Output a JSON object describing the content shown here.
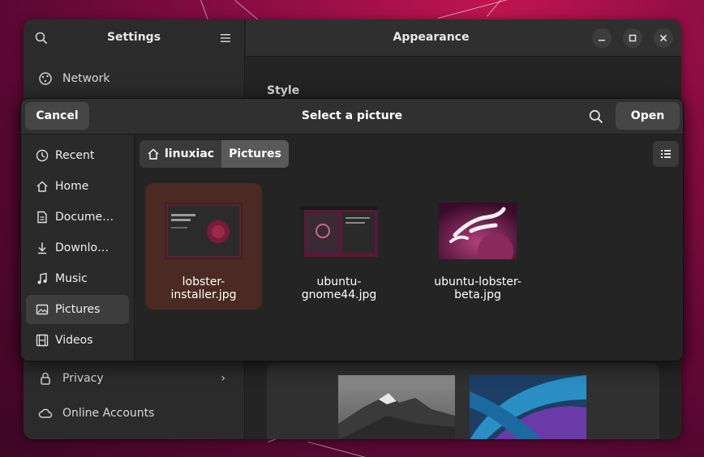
{
  "settings": {
    "sidebar_title": "Settings",
    "window_title": "Appearance",
    "style_label": "Style",
    "sidebar_items": [
      {
        "label": "Network",
        "icon": "network-icon"
      },
      {
        "label": "Privacy",
        "icon": "lock-icon"
      },
      {
        "label": "Online Accounts",
        "icon": "cloud-icon"
      }
    ]
  },
  "dialog": {
    "title": "Select a picture",
    "cancel_label": "Cancel",
    "open_label": "Open",
    "places": [
      {
        "label": "Recent",
        "icon": "clock-icon"
      },
      {
        "label": "Home",
        "icon": "home-icon"
      },
      {
        "label": "Documents",
        "icon": "document-icon"
      },
      {
        "label": "Downloads",
        "icon": "download-icon"
      },
      {
        "label": "Music",
        "icon": "music-icon"
      },
      {
        "label": "Pictures",
        "icon": "picture-icon"
      },
      {
        "label": "Videos",
        "icon": "film-icon"
      }
    ],
    "breadcrumb": {
      "home": "linuxiac",
      "current": "Pictures"
    },
    "files": [
      {
        "name": "lobster-\ninstaller.jpg",
        "selected": true
      },
      {
        "name": "ubuntu-\ngnome44.jpg",
        "selected": false
      },
      {
        "name": "ubuntu-lobster-\nbeta.jpg",
        "selected": false
      }
    ]
  },
  "colors": {
    "accent_selection": "#4a2a22",
    "background_magenta": "#8a0c44"
  }
}
